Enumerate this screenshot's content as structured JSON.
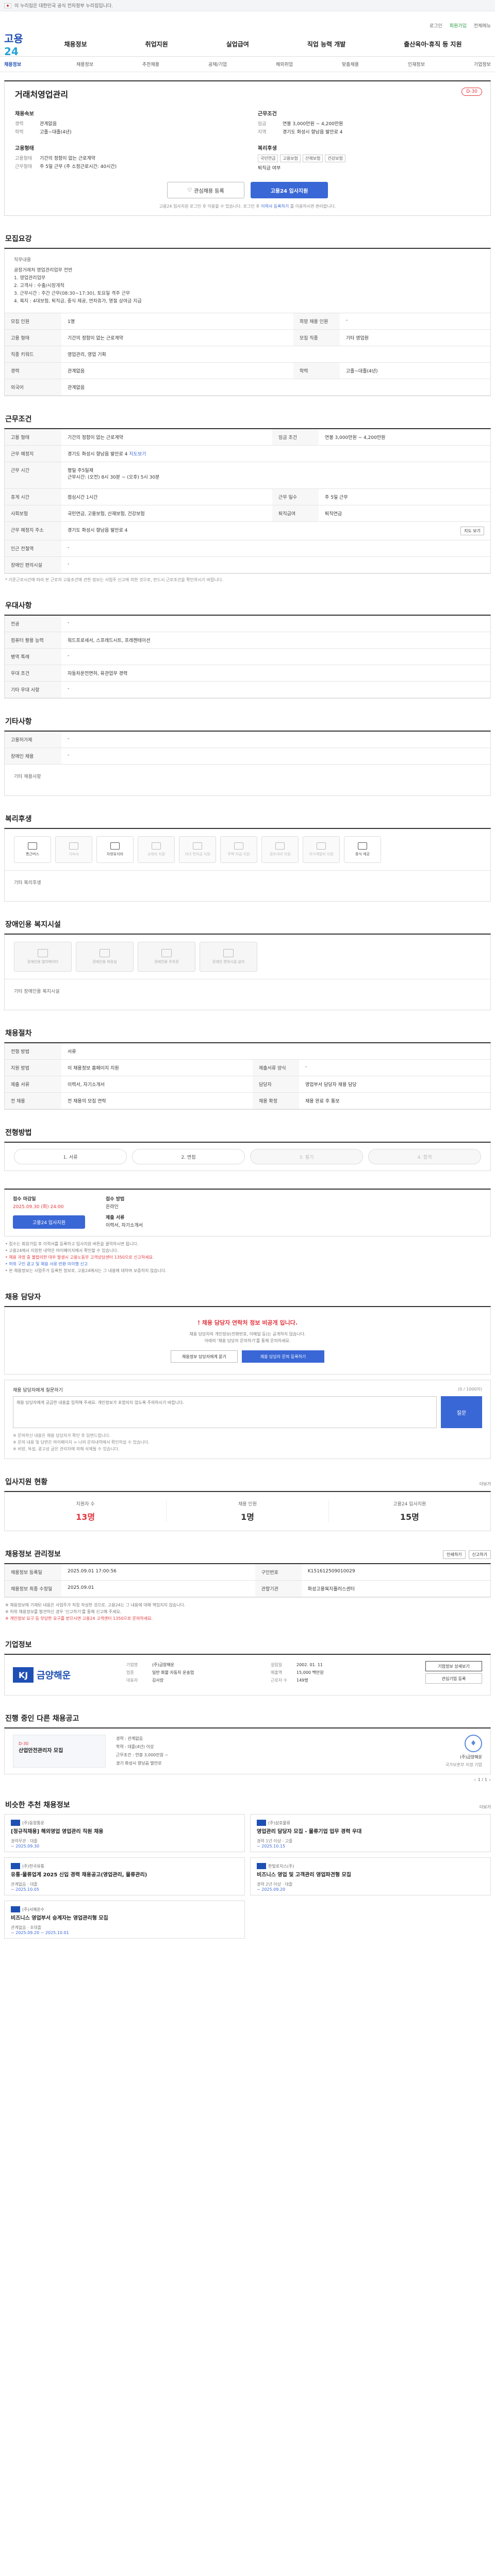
{
  "topbar": {
    "text": "이 누리집은 대한민국 공식 전자정부 누리집입니다."
  },
  "util": {
    "login": "로그인",
    "join": "회원가입",
    "sitemap": "전체메뉴"
  },
  "brand": {
    "logo_a": "고용",
    "logo_b": "24"
  },
  "gnb": [
    "채용정보",
    "취업지원",
    "실업급여",
    "직업 능력 개발",
    "출산육아·휴직 등 지원"
  ],
  "subnav": {
    "first": "채용정보",
    "items": [
      "채용정보",
      "추천채용",
      "공채/기업",
      "해외취업",
      "맞춤채용",
      "인재정보",
      "기업정보"
    ]
  },
  "job": {
    "title": "거래처영업관리",
    "badge": "D-30",
    "left_head": "채용속보",
    "left": [
      {
        "k": "경력",
        "v": "관계없음"
      },
      {
        "k": "학력",
        "v": "고졸~대졸(4년)"
      }
    ],
    "right_head": "근무조건",
    "right": [
      {
        "k": "임금",
        "v": "연봉 3,000만원 ~ 4,200만원"
      },
      {
        "k": "지역",
        "v": "경기도 화성시 향남읍 발안로 4"
      }
    ],
    "left2_head": "고용형태",
    "left2": [
      {
        "k": "고용형태",
        "v": "기간의 정함이 없는 근로계약"
      },
      {
        "k": "근무형태",
        "v": "주 5일 근무 (주 소정근로시간: 40시간)"
      }
    ],
    "right2_head": "복리후생",
    "right2_tags": [
      "국민연금",
      "고용보험",
      "산재보험",
      "건강보험"
    ],
    "right2_extra": "퇴직금 여부",
    "btn_scrap": "관심채용 등록",
    "btn_apply": "고용24 입사지원",
    "note": "고용24 입사지원 로그인 후 이용할 수 있습니다. 로그인 후 ",
    "note_link": "이력서 등록하기",
    "note_tail": " 를 이용하시면 편리합니다."
  },
  "recruit": {
    "title": "모집요강",
    "duty_label": "직무내용",
    "duty_lines": [
      "공장거래처 영업관리업무 전반",
      "1. 영업관리업무",
      "2. 고객사 : 수출/시장개척",
      "3. 근무시간 : 주간 근무(08:30~17:30), 토요일 격주 근무",
      "4. 복지 : 4대보험, 퇴직금, 중식 제공, 연차휴가, 명절 상여금 지급"
    ],
    "rows": [
      {
        "k1": "모집 인원",
        "v1": "1명",
        "k2": "희망 채용 인원",
        "v2": "-"
      },
      {
        "k1": "고용 형태",
        "v1": "기간의 정함이 없는 근로계약",
        "k2": "모집 직종",
        "v2": "기타 영업원"
      },
      {
        "k1": "직종 키워드",
        "v1": "영업관리, 영업 기획",
        "k2": "",
        "v2": ""
      },
      {
        "k1": "경력",
        "v1": "관계없음",
        "k2": "학력",
        "v2": "고졸~대졸(4년)"
      },
      {
        "k1": "외국어",
        "v1": "관계없음",
        "k2": "",
        "v2": ""
      }
    ]
  },
  "cond": {
    "title": "근무조건",
    "r1": {
      "k1": "고용 형태",
      "v1": "기간의 정함이 없는 근로계약",
      "k2": "임금 조건",
      "v2": "연봉 3,000만원 ~ 4,200만원"
    },
    "r2": {
      "k": "근무 예정지",
      "v": "경기도 화성시 향남읍 발안로 4",
      "link": "지도보기"
    },
    "r3": {
      "k": "근무 시간",
      "lines": [
        "평일 주5일제",
        "근무시간: (오전) 8시 30분 ~ (오후) 5시 30분"
      ]
    },
    "r4": {
      "k1": "휴게 시간",
      "v1": "점심시간 1시간",
      "k2": "근무 일수",
      "v2": "주 5일 근무"
    },
    "r5": {
      "k1": "사회보험",
      "v1": "국민연금, 고용보험, 산재보험, 건강보험",
      "k2": "퇴직급여",
      "v2": "퇴직연금"
    },
    "r6": {
      "k": "근무 예정지 주소",
      "v": "경기도 화성시 향남읍 발안로 4",
      "btn": "지도 보기"
    },
    "r7": {
      "k": "인근 전철역",
      "v": "-"
    },
    "r8": {
      "k": "장애인 편의시설",
      "v": "-"
    },
    "note": "* 기준근로시간에 따라 본 근로자 고용조건에 관한 정보는 사업주 신고에 의한 것으로, 반드시 근로조건을 확인하시기 바랍니다."
  },
  "pref": {
    "title": "우대사항",
    "rows": [
      {
        "k": "전공",
        "v": "-"
      },
      {
        "k": "컴퓨터 활용 능력",
        "v": "워드프로세서, 스프레드시트, 프레젠테이션"
      },
      {
        "k": "병역 특례",
        "v": "-"
      },
      {
        "k": "우대 조건",
        "v": "자동차운전면허, 유관업무 경력"
      },
      {
        "k": "기타 우대 사항",
        "v": "-"
      }
    ]
  },
  "other": {
    "title": "기타사항",
    "rows": [
      {
        "k": "고용허가제",
        "v": "-"
      },
      {
        "k": "장애인 채용",
        "v": "-"
      }
    ],
    "box_label": "기타 채용사항"
  },
  "welfare": {
    "title": "복리후생",
    "items": [
      {
        "label": "통근버스",
        "on": true
      },
      {
        "label": "기숙사",
        "on": false
      },
      {
        "label": "차량유지비",
        "on": true
      },
      {
        "label": "교육비 지원",
        "on": false
      },
      {
        "label": "자녀 학자금 지원",
        "on": false
      },
      {
        "label": "주택 자금 지원",
        "on": false
      },
      {
        "label": "경조사비 지원",
        "on": false
      },
      {
        "label": "자기계발비 지원",
        "on": false
      },
      {
        "label": "중식 제공",
        "on": true
      }
    ],
    "box_label": "기타 복리후생"
  },
  "disab": {
    "title": "장애인용 복지시설",
    "items": [
      "장애인용 엘리베이터",
      "장애인용 화장실",
      "장애인용 주차장",
      "장애인 편의시설 설치"
    ],
    "box_label": "기타 장애인용 복지시설"
  },
  "mgr": {
    "title": "채용절차",
    "rows": [
      {
        "k1": "전형 방법",
        "v1": "서류",
        "k2": "",
        "v2": ""
      },
      {
        "k1": "지원 방법",
        "v1": "이 채용정보 홈페이지 지원",
        "k2": "제출서류 양식",
        "v2": "-"
      },
      {
        "k1": "제출 서류",
        "v1": "이력서, 자기소개서",
        "k2": "담당자",
        "v2": "영업부서 담당자 채용 담당"
      },
      {
        "k1": "전 채용",
        "v1": "전 채용의 모집 연락",
        "k2": "채용 확정",
        "v2": "채용 완료 후 통보"
      }
    ]
  },
  "steps": {
    "title": "전형방법",
    "items": [
      {
        "label": "1. 서류",
        "on": true
      },
      {
        "label": "2. 면접",
        "on": true
      },
      {
        "label": "3. 필기",
        "on": false
      },
      {
        "label": "4. 합격",
        "on": false
      }
    ]
  },
  "apply": {
    "c1_head": "접수 마감일",
    "c1_v": "2025.09.30 (화) 24:00",
    "c1_btn": "고용24 입사지원",
    "c2_head": "접수 방법",
    "c2_v": "온라인",
    "c2_head2": "제출 서류",
    "c2_v2": "이력서, 자기소개서",
    "notes": [
      "• 접수는 회원가입 후 이력서를 등록하고 입사지원 버튼을 클릭하시면 됩니다.",
      "• 고용24에서 지원한 내역은 마이페이지에서 확인할 수 있습니다.",
      "• 채용 과정 중 불합리한 대우 발생시 고용노동부 고객상담센터 1350으로 신고하세요.",
      "• 허위 구인 광고 및 채용 서류 반환 미이행 신고",
      "• 본 채용정보는 사업주가 등록한 정보로, 고용24에서는 그 내용에 대하여 보증하지 않습니다."
    ]
  },
  "contact": {
    "title": "채용 담당자",
    "alert": "! 채용 담당자 연락처 정보 비공개 입니다.",
    "sub1": "채용 담당자의 개인정보(전화번호, 이메일 등)는 공개하지 않습니다.",
    "sub2": "아래의 '채용 담당자 문의하기'를 통해 문의하세요.",
    "b1": "채용정보 담당자에게 묻기",
    "b2": "채용 담당자 문의 등록하기",
    "q_head": "채용 담당자에게 질문하기",
    "q_limit": "(0 / 1000자)",
    "q_ph": "채용 담당자에게 궁금한 내용을 입력해 주세요. 개인정보가 포함되지 않도록 주의하시기 바랍니다.",
    "q_btn": "질문",
    "q_notes": [
      "※ 문의하신 내용은 채용 담당자가 확인 후 답변드립니다.",
      "※ 문의 내용 및 답변은 마이페이지 > 나의 문의내역에서 확인하실 수 있습니다.",
      "※ 비방, 욕설, 광고성 글은 관리자에 의해 삭제될 수 있습니다."
    ]
  },
  "stats": {
    "title": "입사지원 현황",
    "more": "더보기",
    "items": [
      {
        "l": "지원자 수",
        "n": "13명",
        "red": true
      },
      {
        "l": "채용 인원",
        "n": "1명",
        "red": false
      },
      {
        "l": "고용24 입사지원",
        "n": "15명",
        "red": false
      }
    ]
  },
  "info": {
    "title": "채용정보 관리정보",
    "btns": [
      "인쇄하기",
      "신고하기"
    ],
    "rows": [
      {
        "k1": "채용정보 등록일",
        "v1": "2025.09.01 17:00:56",
        "k2": "구인번호",
        "v2": "K151612509010029"
      },
      {
        "k1": "채용정보 최종 수정일",
        "v1": "2025.09.01",
        "k2": "관할기관",
        "v2": "화성고용복지플러스센터"
      }
    ],
    "notes": [
      "※ 채용정보에 기재된 내용은 사업주가 직접 작성한 것으로, 고용24는 그 내용에 대해 책임지지 않습니다.",
      "※ 허위 채용정보를 발견하신 경우 '신고하기'를 통해 신고해 주세요.",
      "※ 개인정보 요구 등 부당한 요구를 받으시면 고용24 고객센터 1350으로 문의하세요."
    ]
  },
  "company": {
    "title": "기업정보",
    "logo_mark": "KJ",
    "logo_name": "금양해운",
    "grid": [
      {
        "k": "기업명",
        "v": "(주)금양해운"
      },
      {
        "k": "설립일",
        "v": "2002. 01. 11"
      },
      {
        "k": "업종",
        "v": "일반 화물 자동차 운송업"
      },
      {
        "k": "매출액",
        "v": "15,000 백만원"
      },
      {
        "k": "대표자",
        "v": "김사장"
      },
      {
        "k": "근로자 수",
        "v": "149명"
      }
    ],
    "btns": [
      "기업정보 상세보기",
      "관심기업 등록"
    ]
  },
  "otherjob": {
    "title": "진행 중인 다른 채용공고",
    "dday": "D-30",
    "jtitle": "산업안전관리자 모집",
    "lines": [
      "경력 : 관계없음",
      "학력 : 대졸(4년) 이상",
      "근무조건 : 연봉 3,000만원 ~",
      "경기 화성시 향남읍 발안로"
    ],
    "right_co": "(주)금양해운",
    "right_sub": "국가보훈부 지정 기업",
    "emb": "♦",
    "pager": "1 / 1"
  },
  "recommend": {
    "title": "비슷한 추천 채용정보",
    "more": "더보기",
    "cards": [
      {
        "co": "(주)동양통운",
        "title": "[정규직채용] 해외영업 영업관리 직원 채용",
        "meta": "경력무관 · 대졸",
        "date": "~ 2025.09.30"
      },
      {
        "co": "(주)삼호물류",
        "title": "영업관리 담당자 모집 - 물류기업 업무 경력 우대",
        "meta": "경력 1년 이상 · 고졸",
        "date": "~ 2025.10.15"
      },
      {
        "co": "(주)한국유통",
        "title": "유통·물류업계 2025 신입 경력 채용공고(영업관리, 물류관리)",
        "meta": "관계없음 · 대졸",
        "date": "~ 2025.10.05"
      },
      {
        "co": "한빛로지스(주)",
        "title": "비즈니스 영업 및 고객관리 영업파견형 모집",
        "meta": "경력 2년 이상 · 대졸",
        "date": "~ 2025.09.20"
      },
      {
        "co": "(주)서해운수",
        "title": "비즈니스 영업부서 승계자는 영업관리형 모집",
        "meta": "관계없음 · 초대졸",
        "date": "~ 2025.09.20 ~ 2025.10.01"
      }
    ]
  }
}
